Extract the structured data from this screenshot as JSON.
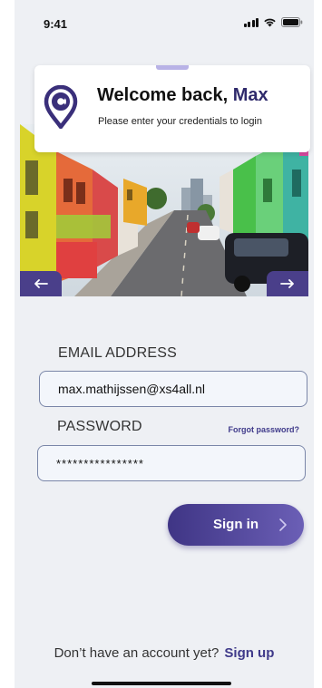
{
  "status_bar": {
    "time": "9:41"
  },
  "welcome": {
    "title_prefix": "Welcome back,",
    "name": "Max",
    "subtitle": "Please enter your credentials to login"
  },
  "form": {
    "email_label": "EMAIL ADDRESS",
    "email_value": "max.mathijssen@xs4all.nl",
    "password_label": "PASSWORD",
    "password_value": "****************",
    "forgot_label": "Forgot password?",
    "signin_label": "Sign in"
  },
  "footer": {
    "prompt": "Don’t have an account yet?",
    "signup_label": "Sign up"
  },
  "colors": {
    "accent": "#3f3a8a",
    "background": "#eef0f4",
    "button_gradient_start": "#3f3585",
    "button_gradient_end": "#6b5fb6"
  },
  "icons": [
    "signal-icon",
    "wifi-icon",
    "battery-icon",
    "location-pin-logo",
    "arrow-left-icon",
    "arrow-right-icon",
    "chevron-right-icon"
  ]
}
